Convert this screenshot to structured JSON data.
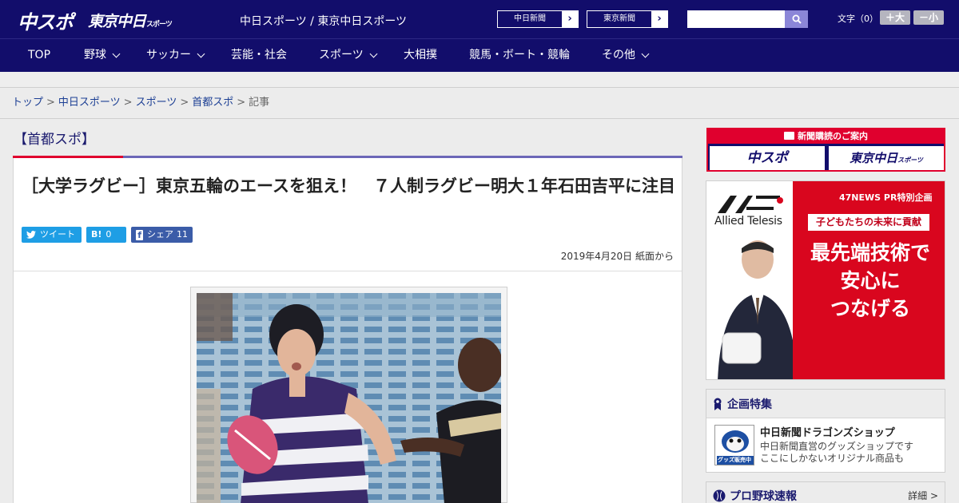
{
  "header": {
    "logo_chuspo": "中スポ",
    "logo_tokyo": "東京中日",
    "logo_tokyo_suffix": "スポーツ",
    "site_name": "中日スポーツ / 東京中日スポーツ",
    "paper_links": [
      "中日新聞",
      "東京新聞"
    ],
    "search_value": "",
    "font_size_label": "文字（0）",
    "font_larger": "＋大",
    "font_smaller": "－小"
  },
  "nav": {
    "items": [
      {
        "label": "TOP",
        "has_menu": false
      },
      {
        "label": "野球",
        "has_menu": true
      },
      {
        "label": "サッカー",
        "has_menu": true
      },
      {
        "label": "芸能・社会",
        "has_menu": false
      },
      {
        "label": "スポーツ",
        "has_menu": true
      },
      {
        "label": "大相撲",
        "has_menu": false
      },
      {
        "label": "競馬・ボート・競輪",
        "has_menu": false
      },
      {
        "label": "その他",
        "has_menu": true
      }
    ]
  },
  "breadcrumb": {
    "items": [
      "トップ",
      "中日スポーツ",
      "スポーツ",
      "首都スポ"
    ],
    "current": "記事",
    "separator": ">"
  },
  "section": {
    "title": "【首都スポ】"
  },
  "article": {
    "headline": "［大学ラグビー］東京五輪のエースを狙え！　７人制ラグビー明大１年石田吉平に注目",
    "share": {
      "tweet_label": "ツイート",
      "hatena_glyph": "B!",
      "hatena_count": "0",
      "facebook_glyph": "f",
      "facebook_label": "シェア",
      "facebook_count": "11"
    },
    "date": "2019年4月20日 紙面から"
  },
  "sidebar": {
    "subscribe": {
      "heading": "新聞購読のご案内",
      "buttons": [
        "中スポ",
        "東京中日"
      ],
      "tokyo_suffix": "スポーツ"
    },
    "ad": {
      "brand": "Allied Telesis",
      "pr": "47NEWS PR特別企画",
      "subheading": "子どもたちの未来に貢献",
      "headline_lines": [
        "最先端技術で",
        "安心に",
        "つなげる"
      ]
    },
    "feature": {
      "heading": "企画特集",
      "thumb_label": "グッズ販売中",
      "title": "中日新聞ドラゴンズショップ",
      "desc_lines": [
        "中日新聞直営のグッズショップです",
        "ここにしかないオリジナル商品も"
      ]
    },
    "baseball": {
      "heading": "プロ野球速報",
      "more": "詳細 >"
    }
  },
  "colors": {
    "header_bg": "#120d6b",
    "accent_red": "#e0002e",
    "rule_purple": "#6c67b8",
    "link_blue": "#1c3f94",
    "twitter": "#1e9ee5",
    "facebook": "#3b5ca8"
  }
}
